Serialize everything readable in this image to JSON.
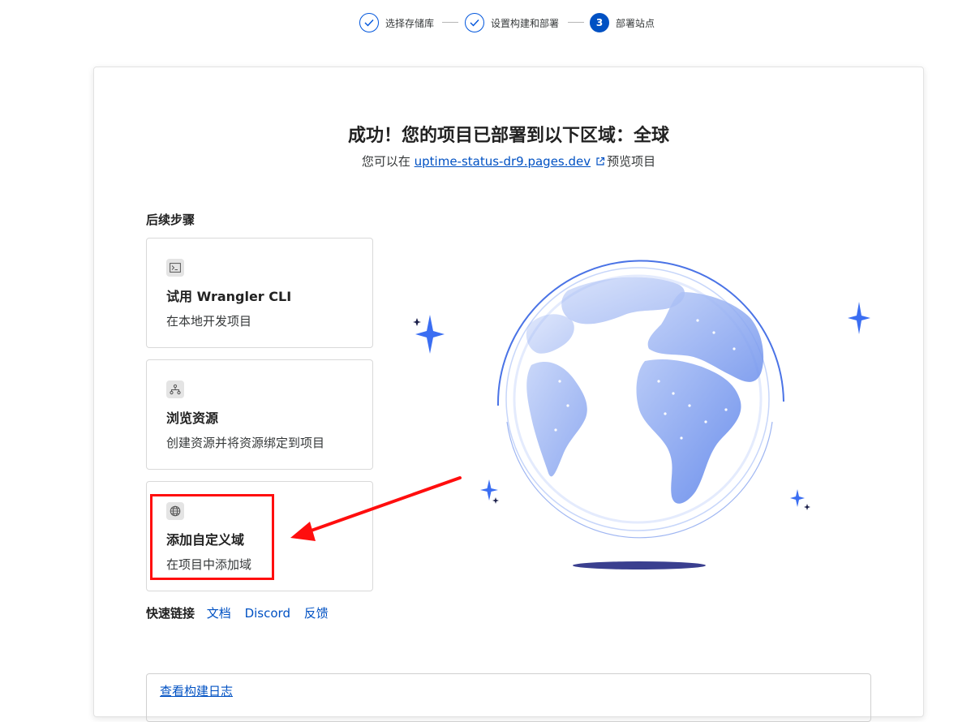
{
  "stepper": {
    "steps": [
      {
        "label": "选择存储库",
        "state": "done"
      },
      {
        "label": "设置构建和部署",
        "state": "done"
      },
      {
        "label": "部署站点",
        "state": "active",
        "number": "3"
      }
    ]
  },
  "header": {
    "title": "成功！您的项目已部署到以下区域：全球",
    "subtitle_prefix": "您可以在",
    "subtitle_link": "uptime-status-dr9.pages.dev",
    "subtitle_suffix": "预览项目"
  },
  "next_steps": {
    "heading": "后续步骤",
    "tiles": [
      {
        "icon": "terminal-icon",
        "title": "试用 Wrangler CLI",
        "description": "在本地开发项目"
      },
      {
        "icon": "network-icon",
        "title": "浏览资源",
        "description": "创建资源并将资源绑定到项目"
      },
      {
        "icon": "globe-icon",
        "title": "添加自定义域",
        "description": "在项目中添加域"
      }
    ]
  },
  "quick_links": {
    "label": "快速链接",
    "links": [
      "文档",
      "Discord",
      "反馈"
    ]
  },
  "build_log": {
    "link": "查看构建日志"
  },
  "colors": {
    "accent": "#0051c3",
    "annotation": "#ff0e0e",
    "globe_blue": "#6b8fe8"
  }
}
